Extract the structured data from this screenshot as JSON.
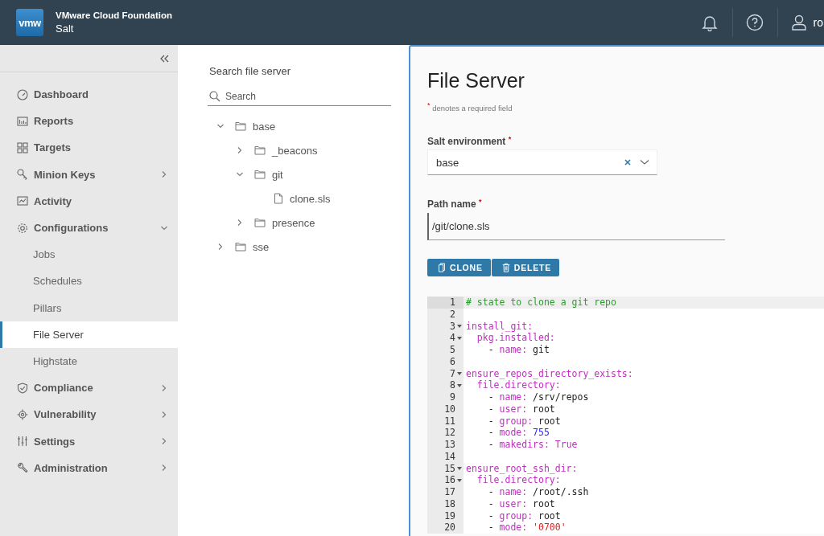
{
  "header": {
    "logo": "vmw",
    "product": "VMware Cloud Foundation",
    "app": "Salt",
    "user": "ro"
  },
  "sidebar": {
    "items": [
      {
        "label": "Dashboard",
        "kind": "link",
        "selected": false
      },
      {
        "label": "Reports",
        "kind": "link",
        "selected": false
      },
      {
        "label": "Targets",
        "kind": "link",
        "selected": false
      },
      {
        "label": "Minion Keys",
        "kind": "group",
        "expanded": false,
        "selected": false
      },
      {
        "label": "Activity",
        "kind": "link",
        "selected": false
      },
      {
        "label": "Configurations",
        "kind": "group",
        "expanded": true,
        "selected": false,
        "children": [
          {
            "label": "Jobs",
            "selected": false
          },
          {
            "label": "Schedules",
            "selected": false
          },
          {
            "label": "Pillars",
            "selected": false
          },
          {
            "label": "File Server",
            "selected": true
          },
          {
            "label": "Highstate",
            "selected": false
          }
        ]
      },
      {
        "label": "Compliance",
        "kind": "group",
        "expanded": false,
        "selected": false
      },
      {
        "label": "Vulnerability",
        "kind": "group",
        "expanded": false,
        "selected": false
      },
      {
        "label": "Settings",
        "kind": "group",
        "expanded": false,
        "selected": false
      },
      {
        "label": "Administration",
        "kind": "group",
        "expanded": false,
        "selected": false
      }
    ]
  },
  "file_tree": {
    "title": "Search file server",
    "search": {
      "placeholder": "Search"
    },
    "items": [
      {
        "label": "base",
        "kind": "folder",
        "expanded": true,
        "children": [
          {
            "label": "_beacons",
            "kind": "folder",
            "expanded": false
          },
          {
            "label": "git",
            "kind": "folder",
            "expanded": true,
            "children": [
              {
                "label": "clone.sls",
                "kind": "file"
              }
            ]
          },
          {
            "label": "presence",
            "kind": "folder",
            "expanded": false
          }
        ]
      },
      {
        "label": "sse",
        "kind": "folder",
        "expanded": false
      }
    ]
  },
  "form": {
    "title": "File Server",
    "note": {
      "mark": "*",
      "text": "denotes a required field"
    },
    "environment": {
      "label": "Salt environment",
      "required_mark": "*",
      "value": "base"
    },
    "path": {
      "label": "Path name",
      "required_mark": "*",
      "value": "/git/clone.sls"
    },
    "buttons": [
      {
        "label": "CLONE"
      },
      {
        "label": "DELETE"
      }
    ]
  },
  "editor": {
    "lines": [
      {
        "n": "1",
        "fold": false,
        "active": true,
        "tokens": [
          {
            "kind": "comment",
            "text": "# state to clone a git repo"
          }
        ]
      },
      {
        "n": "2",
        "fold": false,
        "active": false
      },
      {
        "n": "3",
        "fold": true,
        "active": false,
        "tokens": [
          {
            "kind": "key",
            "text": "install_git:"
          }
        ]
      },
      {
        "n": "4",
        "fold": true,
        "active": false,
        "tokens": [
          {
            "kind": "key",
            "text": "  pkg.installed:"
          }
        ]
      },
      {
        "n": "5",
        "fold": false,
        "active": false,
        "tokens": [
          {
            "kind": "plain",
            "text": "    - "
          },
          {
            "kind": "key",
            "text": "name:"
          },
          {
            "kind": "plain",
            "text": " git"
          }
        ]
      },
      {
        "n": "6",
        "fold": false,
        "active": false
      },
      {
        "n": "7",
        "fold": true,
        "active": false,
        "tokens": [
          {
            "kind": "key",
            "text": "ensure_repos_directory_exists:"
          }
        ]
      },
      {
        "n": "8",
        "fold": true,
        "active": false,
        "tokens": [
          {
            "kind": "key",
            "text": "  file.directory:"
          }
        ]
      },
      {
        "n": "9",
        "fold": false,
        "active": false,
        "tokens": [
          {
            "kind": "plain",
            "text": "    - "
          },
          {
            "kind": "key",
            "text": "name:"
          },
          {
            "kind": "plain",
            "text": " /srv/repos"
          }
        ]
      },
      {
        "n": "10",
        "fold": false,
        "active": false,
        "tokens": [
          {
            "kind": "plain",
            "text": "    - "
          },
          {
            "kind": "key",
            "text": "user:"
          },
          {
            "kind": "plain",
            "text": " root"
          }
        ]
      },
      {
        "n": "11",
        "fold": false,
        "active": false,
        "tokens": [
          {
            "kind": "plain",
            "text": "    - "
          },
          {
            "kind": "key",
            "text": "group:"
          },
          {
            "kind": "plain",
            "text": " root"
          }
        ]
      },
      {
        "n": "12",
        "fold": false,
        "active": false,
        "tokens": [
          {
            "kind": "plain",
            "text": "    - "
          },
          {
            "kind": "key",
            "text": "mode:"
          },
          {
            "kind": "number",
            "text": " 755"
          }
        ]
      },
      {
        "n": "13",
        "fold": false,
        "active": false,
        "tokens": [
          {
            "kind": "plain",
            "text": "    - "
          },
          {
            "kind": "key",
            "text": "makedirs: True"
          }
        ]
      },
      {
        "n": "14",
        "fold": false,
        "active": false
      },
      {
        "n": "15",
        "fold": true,
        "active": false,
        "tokens": [
          {
            "kind": "key",
            "text": "ensure_root_ssh_dir:"
          }
        ]
      },
      {
        "n": "16",
        "fold": true,
        "active": false,
        "tokens": [
          {
            "kind": "key",
            "text": "  file.directory:"
          }
        ]
      },
      {
        "n": "17",
        "fold": false,
        "active": false,
        "tokens": [
          {
            "kind": "plain",
            "text": "    - "
          },
          {
            "kind": "key",
            "text": "name:"
          },
          {
            "kind": "plain",
            "text": " /root/.ssh"
          }
        ]
      },
      {
        "n": "18",
        "fold": false,
        "active": false,
        "tokens": [
          {
            "kind": "plain",
            "text": "    - "
          },
          {
            "kind": "key",
            "text": "user:"
          },
          {
            "kind": "plain",
            "text": " root"
          }
        ]
      },
      {
        "n": "19",
        "fold": false,
        "active": false,
        "tokens": [
          {
            "kind": "plain",
            "text": "    - "
          },
          {
            "kind": "key",
            "text": "group:"
          },
          {
            "kind": "plain",
            "text": " root"
          }
        ]
      },
      {
        "n": "20",
        "fold": false,
        "active": false,
        "tokens": [
          {
            "kind": "plain",
            "text": "    - "
          },
          {
            "kind": "key",
            "text": "mode:"
          },
          {
            "kind": "string",
            "text": " '0700'"
          }
        ]
      }
    ]
  }
}
